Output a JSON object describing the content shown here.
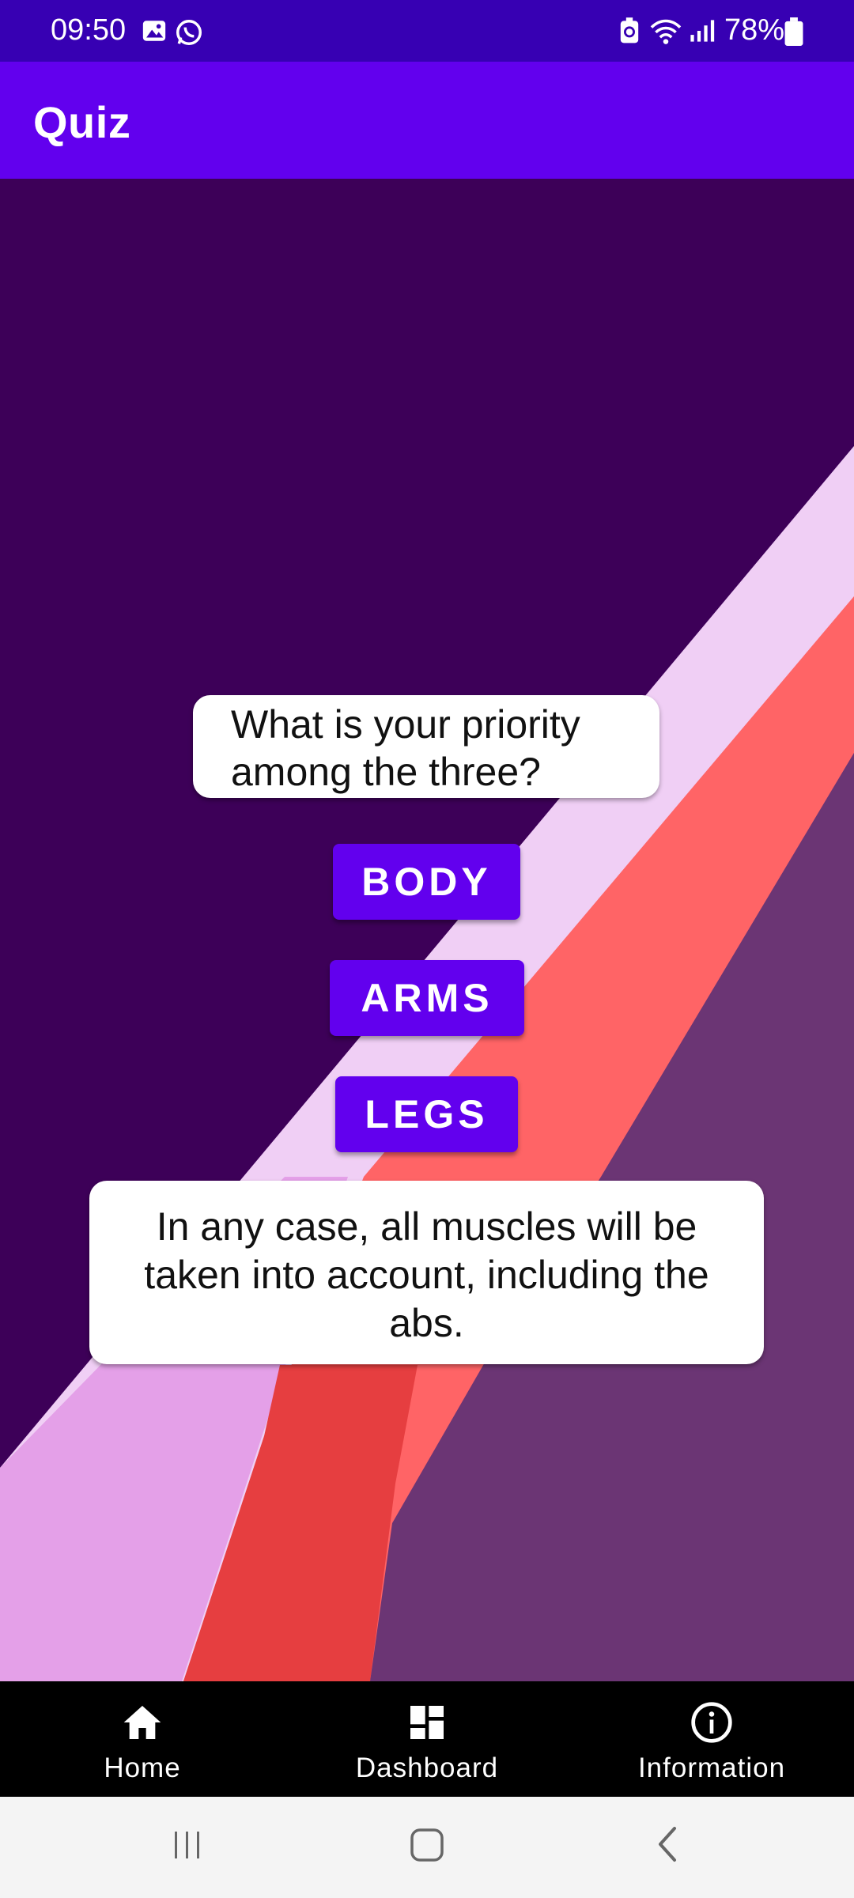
{
  "status_bar": {
    "time": "09:50",
    "battery": "78%",
    "icons": [
      "image-icon",
      "whatsapp-icon",
      "battery-saver-icon",
      "wifi-icon",
      "signal-icon",
      "battery-icon"
    ]
  },
  "app_bar": {
    "title": "Quiz"
  },
  "quiz": {
    "question": "What is your priority among the three?",
    "options": [
      "BODY",
      "ARMS",
      "LEGS"
    ],
    "note": "In any case, all muscles will be taken into account, including the abs."
  },
  "bottom_nav": {
    "items": [
      {
        "label": "Home",
        "icon": "home-icon"
      },
      {
        "label": "Dashboard",
        "icon": "dashboard-icon"
      },
      {
        "label": "Information",
        "icon": "info-icon"
      }
    ]
  },
  "system_nav": {
    "buttons": [
      "recents-icon",
      "home-circle-icon",
      "back-icon"
    ]
  },
  "colors": {
    "status_bar": "#3700b3",
    "app_bar": "#6200ee",
    "primary_button": "#6200ee",
    "background": "#3d0058",
    "bottom_nav": "#000000"
  }
}
